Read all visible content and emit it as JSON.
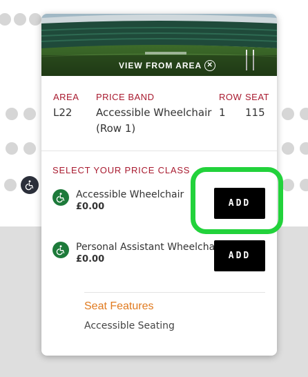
{
  "view": {
    "link_label": "VIEW FROM AREA",
    "close_icon": "close-circle-icon"
  },
  "seat_info": {
    "headers": {
      "area": "AREA",
      "price_band": "PRICE BAND",
      "row": "ROW",
      "seat": "SEAT"
    },
    "values": {
      "area": "L22",
      "price_band_line1": "Accessible Wheelchair",
      "price_band_line2": "(Row 1)",
      "row": "1",
      "seat": "115"
    }
  },
  "price_class": {
    "title": "SELECT YOUR PRICE CLASS",
    "options": [
      {
        "name": "Accessible Wheelchair",
        "price": "£0.00",
        "button": "ADD",
        "icon": "wheelchair-icon"
      },
      {
        "name": "Personal Assistant Wheelchair",
        "price": "£0.00",
        "button": "ADD",
        "icon": "wheelchair-icon"
      }
    ]
  },
  "features": {
    "title": "Seat Features",
    "items": [
      "Accessible Seating"
    ]
  },
  "colors": {
    "accent_red": "#a8192e",
    "wheelchair_green": "#1d7a3a",
    "features_orange": "#e07a1f",
    "highlight_green": "#22d23b",
    "button_black": "#000000"
  }
}
